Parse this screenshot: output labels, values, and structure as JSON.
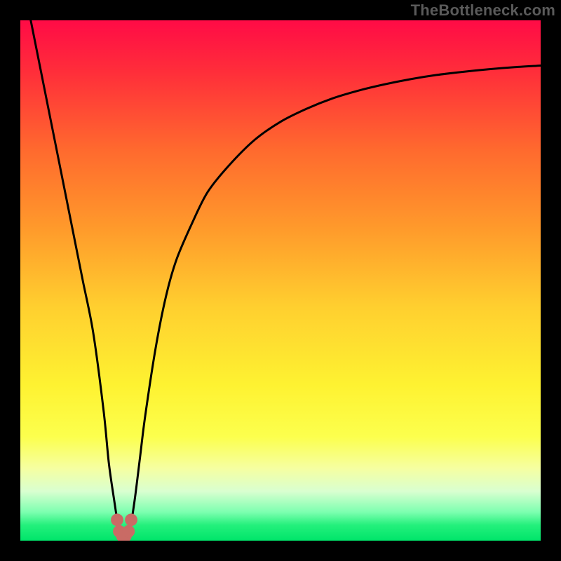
{
  "watermark": "TheBottleneck.com",
  "chart_data": {
    "type": "line",
    "title": "",
    "xlabel": "",
    "ylabel": "",
    "xlim": [
      0,
      100
    ],
    "ylim": [
      0,
      100
    ],
    "background": {
      "type": "vertical-gradient",
      "stops": [
        {
          "pos": 0.0,
          "color": "#ff0b46"
        },
        {
          "pos": 0.1,
          "color": "#ff2e3a"
        },
        {
          "pos": 0.25,
          "color": "#ff6a2e"
        },
        {
          "pos": 0.4,
          "color": "#ff9a2b"
        },
        {
          "pos": 0.55,
          "color": "#ffcf2f"
        },
        {
          "pos": 0.7,
          "color": "#fef231"
        },
        {
          "pos": 0.8,
          "color": "#fcff4d"
        },
        {
          "pos": 0.86,
          "color": "#f6ffa0"
        },
        {
          "pos": 0.905,
          "color": "#d9ffd0"
        },
        {
          "pos": 0.945,
          "color": "#7dffb0"
        },
        {
          "pos": 0.97,
          "color": "#24f07c"
        },
        {
          "pos": 1.0,
          "color": "#00e56a"
        }
      ]
    },
    "series": [
      {
        "name": "bottleneck-curve",
        "color": "#000000",
        "x": [
          2,
          4,
          6,
          8,
          10,
          12,
          14,
          16,
          17,
          18,
          18.8,
          19.5,
          20.5,
          21.2,
          22,
          23,
          24,
          26,
          28,
          30,
          33,
          36,
          40,
          45,
          50,
          55,
          60,
          65,
          70,
          75,
          80,
          85,
          90,
          95,
          100
        ],
        "y": [
          100,
          90,
          80,
          70,
          60,
          50,
          40,
          25,
          15,
          8,
          3,
          1,
          1,
          3,
          8,
          16,
          24,
          37,
          47,
          54,
          61,
          67,
          72,
          77,
          80.5,
          83,
          85,
          86.5,
          87.7,
          88.7,
          89.5,
          90.1,
          90.6,
          91.0,
          91.3
        ]
      }
    ],
    "valley_marker": {
      "color": "#c96b65",
      "points_x": [
        18.6,
        19.0,
        19.6,
        20.2,
        20.8,
        21.3
      ],
      "points_y": [
        4.0,
        1.8,
        0.9,
        0.9,
        1.8,
        4.0
      ],
      "radius_pct": 1.2
    }
  }
}
